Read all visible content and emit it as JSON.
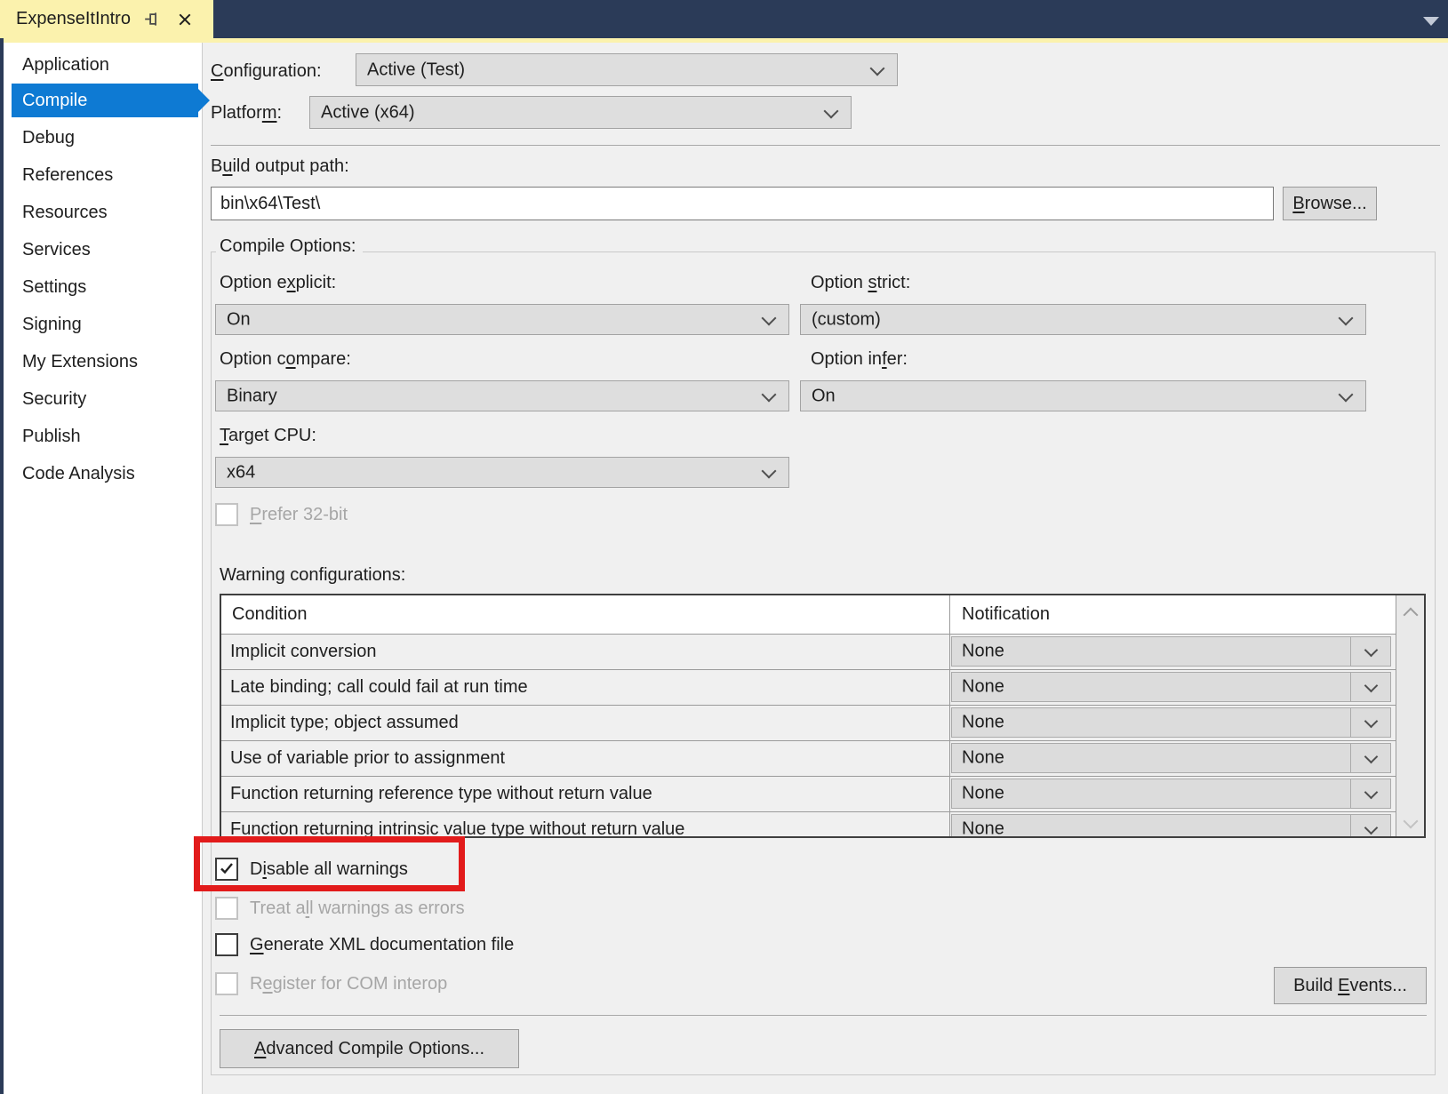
{
  "window": {
    "tab_title": "ExpenseItIntro"
  },
  "colors": {
    "titlebar": "#2B3B58",
    "tab_bg": "#FBF2AD",
    "accent_blue": "#0E7AD3",
    "page_bg": "#F0F0F0",
    "highlight_red": "#E21B1B"
  },
  "icons": {
    "tab_pin": "pin-icon",
    "tab_close": "close-icon",
    "titlebar_caret": "chevron-down-icon",
    "combo_caret": "chevron-down-icon",
    "scrollbar_up": "chevron-up-icon",
    "scrollbar_down": "chevron-down-icon"
  },
  "sidebar": {
    "items": [
      {
        "label": "Application",
        "selected": false
      },
      {
        "label": "Compile",
        "selected": true
      },
      {
        "label": "Debug",
        "selected": false
      },
      {
        "label": "References",
        "selected": false
      },
      {
        "label": "Resources",
        "selected": false
      },
      {
        "label": "Services",
        "selected": false
      },
      {
        "label": "Settings",
        "selected": false
      },
      {
        "label": "Signing",
        "selected": false
      },
      {
        "label": "My Extensions",
        "selected": false
      },
      {
        "label": "Security",
        "selected": false
      },
      {
        "label": "Publish",
        "selected": false
      },
      {
        "label": "Code Analysis",
        "selected": false
      }
    ]
  },
  "config_bar": {
    "configuration": {
      "label_pre": "",
      "label_mn": "C",
      "label_post": "onfiguration:",
      "value": "Active (Test)"
    },
    "platform": {
      "label_pre": "Platfor",
      "label_mn": "m",
      "label_post": ":",
      "value": "Active (x64)"
    }
  },
  "build_output": {
    "label_pre": "B",
    "label_mn": "u",
    "label_post": "ild output path:",
    "value": "bin\\x64\\Test\\",
    "browse": {
      "label_pre": "",
      "label_mn": "B",
      "label_post": "rowse..."
    }
  },
  "compile_options": {
    "group_label": "Compile Options:",
    "option_explicit": {
      "label_pre": "Option e",
      "label_mn": "x",
      "label_post": "plicit:",
      "value": "On"
    },
    "option_strict": {
      "label_pre": "Option ",
      "label_mn": "s",
      "label_post": "trict:",
      "value": "(custom)"
    },
    "option_compare": {
      "label_pre": "Option c",
      "label_mn": "o",
      "label_post": "mpare:",
      "value": "Binary"
    },
    "option_infer": {
      "label_pre": "Option in",
      "label_mn": "f",
      "label_post": "er:",
      "value": "On"
    },
    "target_cpu": {
      "label_pre": "",
      "label_mn": "T",
      "label_post": "arget CPU:",
      "value": "x64"
    },
    "prefer_32bit": {
      "label_pre": "",
      "label_mn": "P",
      "label_post": "refer 32-bit",
      "checked": false,
      "enabled": false
    }
  },
  "warning_table": {
    "label": "Warning configurations:",
    "columns": [
      "Condition",
      "Notification"
    ],
    "rows": [
      {
        "condition": "Implicit conversion",
        "notification": "None"
      },
      {
        "condition": "Late binding; call could fail at run time",
        "notification": "None"
      },
      {
        "condition": "Implicit type; object assumed",
        "notification": "None"
      },
      {
        "condition": "Use of variable prior to assignment",
        "notification": "None"
      },
      {
        "condition": "Function returning reference type without return value",
        "notification": "None"
      },
      {
        "condition": "Function returning intrinsic value type without return value",
        "notification": "None"
      }
    ]
  },
  "checkboxes": {
    "disable_all_warnings": {
      "label_pre": "D",
      "label_mn": "i",
      "label_post": "sable all warnings",
      "checked": true,
      "enabled": true
    },
    "treat_warnings_as_errors": {
      "label_pre": "Treat a",
      "label_mn": "l",
      "label_post": "l warnings as errors",
      "checked": false,
      "enabled": false
    },
    "generate_xml_doc": {
      "label_pre": "",
      "label_mn": "G",
      "label_post": "enerate XML documentation file",
      "checked": false,
      "enabled": true
    },
    "register_com_interop": {
      "label_pre": "R",
      "label_mn": "e",
      "label_post": "gister for COM interop",
      "checked": false,
      "enabled": false
    }
  },
  "buttons": {
    "build_events": {
      "label_pre": "Build ",
      "label_mn": "E",
      "label_post": "vents..."
    },
    "advanced_compile": {
      "label_pre": "",
      "label_mn": "A",
      "label_post": "dvanced Compile Options..."
    }
  }
}
